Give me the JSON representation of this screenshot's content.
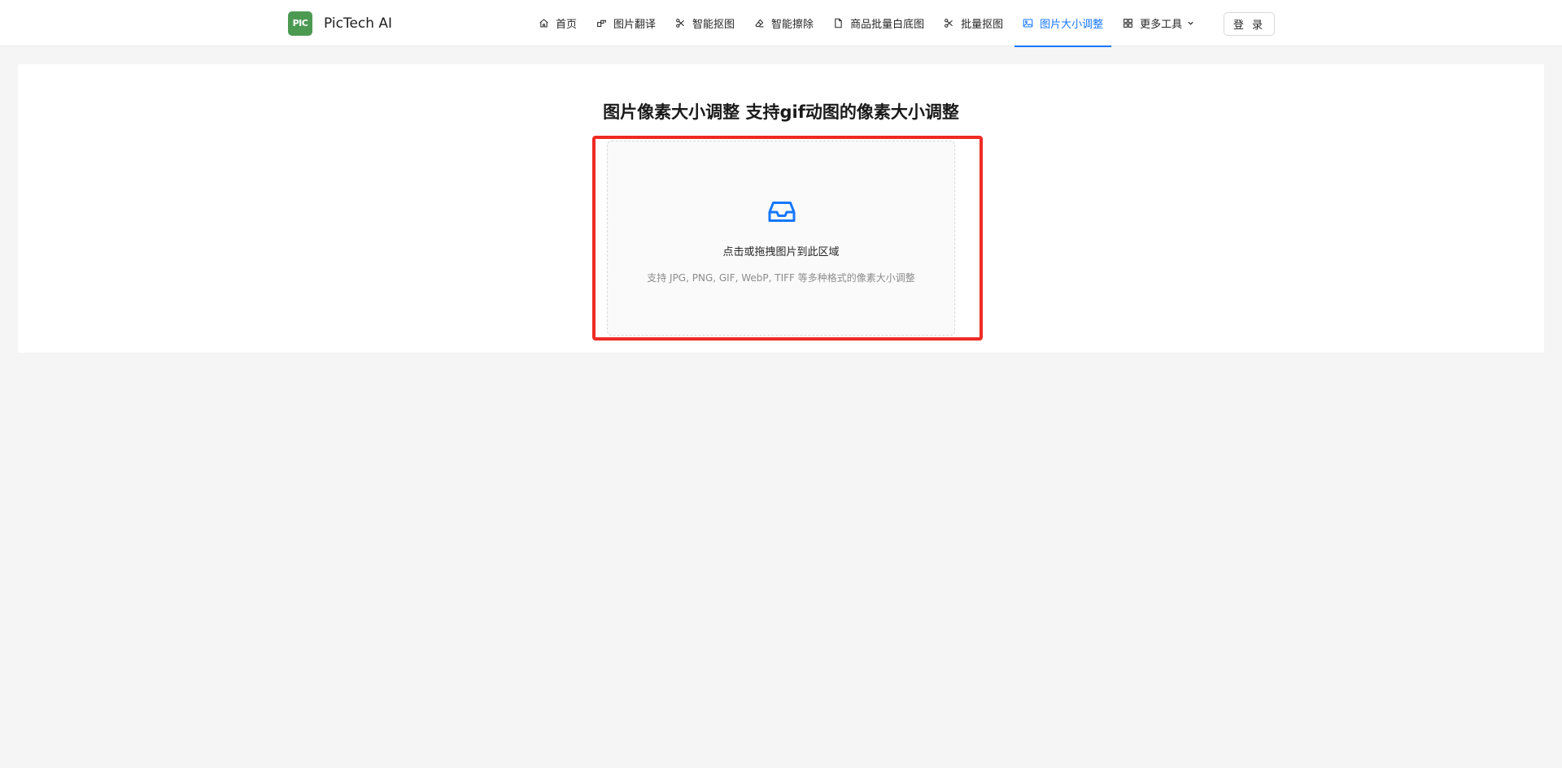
{
  "brand": {
    "logo_mark": "PIC",
    "name": "PicTech AI"
  },
  "nav": {
    "items": [
      {
        "label": "首页",
        "icon": "home-icon"
      },
      {
        "label": "图片翻译",
        "icon": "translate-icon"
      },
      {
        "label": "智能抠图",
        "icon": "scissors-icon"
      },
      {
        "label": "智能擦除",
        "icon": "eraser-icon"
      },
      {
        "label": "商品批量白底图",
        "icon": "file-icon"
      },
      {
        "label": "批量抠图",
        "icon": "scissors-icon"
      },
      {
        "label": "图片大小调整",
        "icon": "image-icon",
        "active": true
      },
      {
        "label": "更多工具",
        "icon": "grid-icon"
      }
    ],
    "login_label": "登 录"
  },
  "main": {
    "title": "图片像素大小调整 支持gif动图的像素大小调整",
    "upload": {
      "text": "点击或拖拽图片到此区域",
      "hint": "支持 JPG, PNG, GIF, WebP, TIFF 等多种格式的像素大小调整",
      "icon": "inbox-icon"
    }
  },
  "colors": {
    "accent": "#1677ff",
    "logo": "#4c9a52",
    "highlight": "#ee2b24",
    "background": "#f5f5f5"
  }
}
